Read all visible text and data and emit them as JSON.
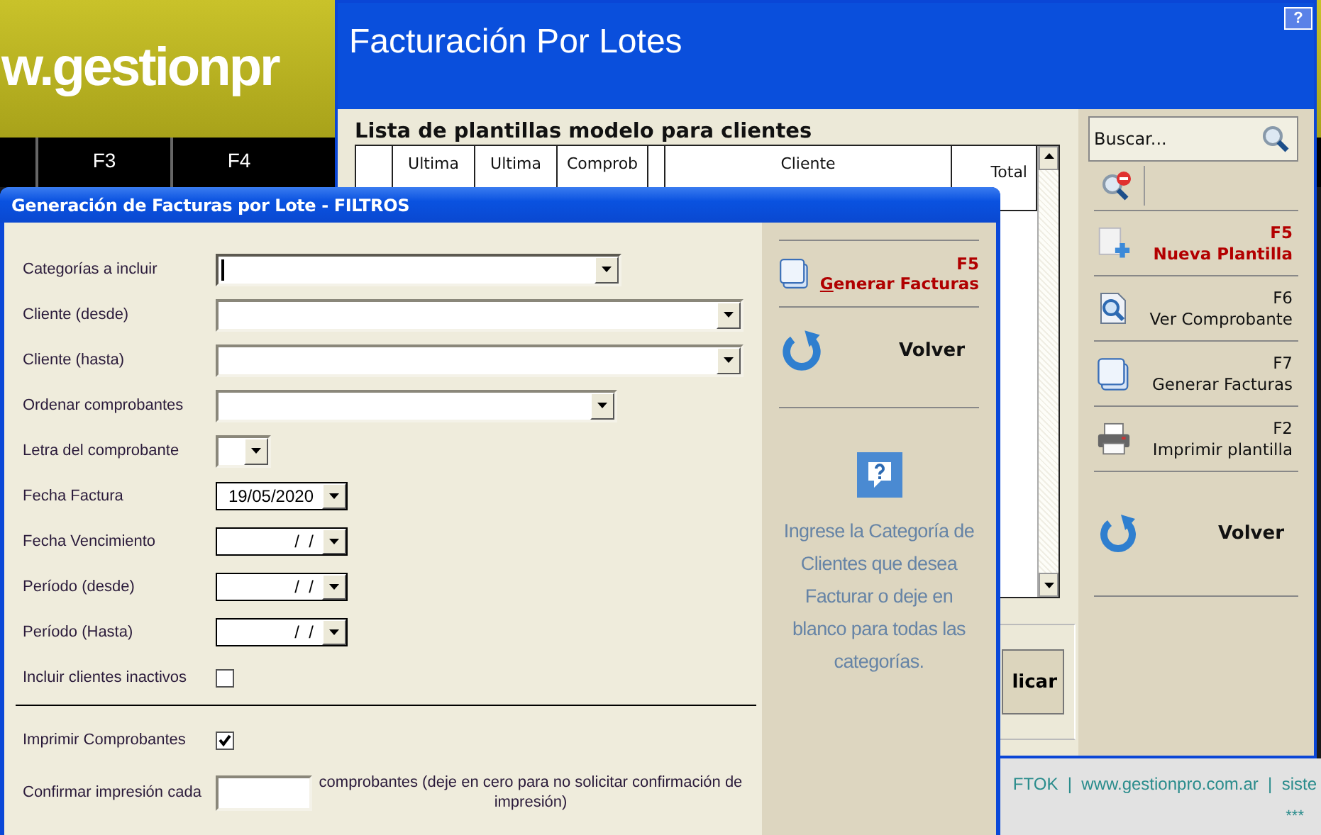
{
  "background_app": {
    "banner_text": "w.gestionpr",
    "function_keys": [
      "F3",
      "F4"
    ],
    "status_bar": {
      "links": "FTOK  |  www.gestionpro.com.ar  |  siste",
      "note": "***"
    }
  },
  "main_window": {
    "title": "Facturación Por Lotes",
    "help_button": "?",
    "list_title": "Lista de plantillas modelo para clientes",
    "table": {
      "columns": [
        {
          "kind": "blank"
        },
        {
          "kind": "text",
          "label": "Ultima"
        },
        {
          "kind": "text",
          "label": "Ultima"
        },
        {
          "kind": "text",
          "label": "Comprob"
        },
        {
          "kind": "blank"
        },
        {
          "kind": "text",
          "label": "Cliente"
        },
        {
          "kind": "number",
          "label": "Total"
        }
      ]
    },
    "apply_button": "licar",
    "search": {
      "placeholder": "Buscar..."
    },
    "actions": [
      {
        "kind": "new",
        "key": "F5",
        "label": "Nueva Plantilla",
        "highlighted": true
      },
      {
        "kind": "view",
        "key": "F6",
        "label": "Ver Comprobante",
        "highlighted": false
      },
      {
        "kind": "generate",
        "key": "F7",
        "label": "Generar Facturas",
        "highlighted": false
      },
      {
        "kind": "print",
        "key": "F2",
        "label": "Imprimir plantilla",
        "highlighted": false
      },
      {
        "kind": "back",
        "label": "Volver",
        "highlighted": false
      }
    ]
  },
  "dialog": {
    "title": "Generación de Facturas por Lote - FILTROS",
    "fields": [
      {
        "kind": "combo",
        "label": "Categorías a incluir",
        "focused": true
      },
      {
        "kind": "combo",
        "label": "Cliente (desde)",
        "focused": false
      },
      {
        "kind": "combo",
        "label": "Cliente (hasta)",
        "focused": false
      },
      {
        "kind": "combo",
        "label": "Ordenar comprobantes",
        "focused": false
      },
      {
        "kind": "combo",
        "label": "Letra del comprobante",
        "focused": false
      },
      {
        "kind": "date",
        "label": "Fecha Factura",
        "value": "19/05/2020"
      },
      {
        "kind": "date",
        "label": "Fecha Vencimiento",
        "value": "/  /"
      },
      {
        "kind": "date",
        "label": "Período (desde)",
        "value": "/  /"
      },
      {
        "kind": "date",
        "label": "Período (Hasta)",
        "value": "/  /"
      },
      {
        "kind": "checkbox",
        "label": "Incluir clientes inactivos",
        "checked": false
      }
    ],
    "print_options": [
      {
        "kind": "checkbox",
        "label": "Imprimir Comprobantes",
        "checked": true
      },
      {
        "kind": "number",
        "label": "Confirmar impresión cada",
        "note": "comprobantes (deje en cero para no solicitar confirmación de impresión)"
      }
    ],
    "actions": [
      {
        "kind": "generate",
        "key": "F5",
        "label": "Generar Facturas",
        "highlighted": true
      },
      {
        "kind": "back",
        "label": "Volver",
        "highlighted": false
      }
    ],
    "help_text": "Ingrese la Categoría de Clientes que desea Facturar o deje en blanco para todas las categorías."
  }
}
